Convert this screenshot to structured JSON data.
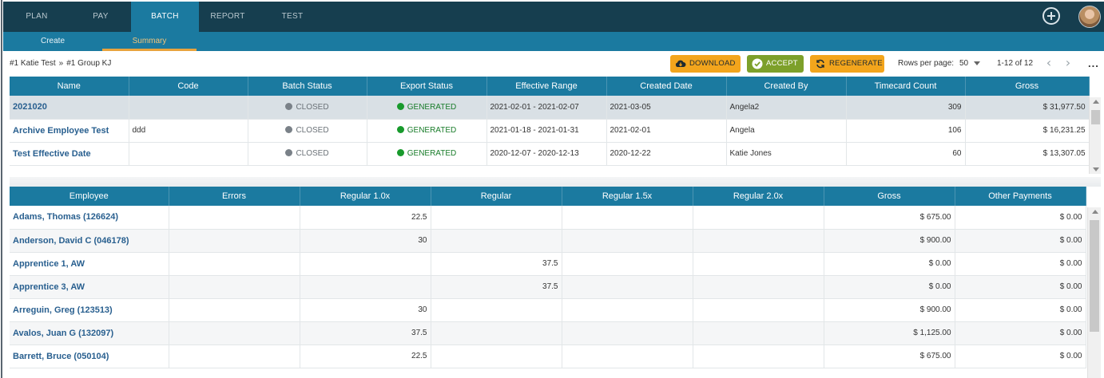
{
  "nav": {
    "tabs": [
      {
        "label": "PLAN"
      },
      {
        "label": "PAY"
      },
      {
        "label": "BATCH"
      },
      {
        "label": "REPORT"
      },
      {
        "label": "TEST"
      }
    ],
    "active_tab": "BATCH"
  },
  "subnav": {
    "tabs": [
      {
        "label": "Create"
      },
      {
        "label": "Summary"
      }
    ],
    "active_tab": "Summary"
  },
  "breadcrumb": {
    "items": [
      "#1 Katie Test",
      "»",
      "#1 Group KJ"
    ]
  },
  "toolbar": {
    "download_label": "DOWNLOAD",
    "accept_label": "ACCEPT",
    "regenerate_label": "REGENERATE",
    "rows_per_page_label": "Rows per page:",
    "rows_per_page_value": "50",
    "range_label": "1-12 of 12",
    "prev_icon": "chevron-left-icon",
    "next_icon": "chevron-right-icon",
    "more_label": "..."
  },
  "colors": {
    "nav_bg": "#163e4f",
    "accent": "#1b7aa0",
    "orange": "#f3a51c",
    "green": "#7da02a",
    "status_closed": "#7a8188",
    "status_generated": "#189a2c"
  },
  "batch_table": {
    "columns": [
      "Name",
      "Code",
      "Batch Status",
      "Export Status",
      "Effective Range",
      "Created Date",
      "Created By",
      "Timecard Count",
      "Gross"
    ],
    "rows": [
      {
        "name": "2021020",
        "code": "",
        "batch_status": "CLOSED",
        "export_status": "GENERATED",
        "effective_range": "2021-02-01 - 2021-02-07",
        "created_date": "2021-03-05",
        "created_by": "Angela2",
        "timecard_count": "309",
        "gross": "$ 31,977.50"
      },
      {
        "name": "Archive Employee Test",
        "code": "ddd",
        "batch_status": "CLOSED",
        "export_status": "GENERATED",
        "effective_range": "2021-01-18 - 2021-01-31",
        "created_date": "2021-02-01",
        "created_by": "Angela",
        "timecard_count": "106",
        "gross": "$ 16,231.25"
      },
      {
        "name": "Test Effective Date",
        "code": "",
        "batch_status": "CLOSED",
        "export_status": "GENERATED",
        "effective_range": "2020-12-07 - 2020-12-13",
        "created_date": "2020-12-22",
        "created_by": "Katie Jones",
        "timecard_count": "60",
        "gross": "$ 13,307.05"
      }
    ]
  },
  "employee_table": {
    "columns": [
      "Employee",
      "Errors",
      "Regular 1.0x",
      "Regular",
      "Regular 1.5x",
      "Regular 2.0x",
      "Gross",
      "Other Payments"
    ],
    "rows": [
      {
        "employee": "Adams, Thomas (126624)",
        "errors": "",
        "reg10": "22.5",
        "regular": "",
        "reg15": "",
        "reg20": "",
        "gross": "$ 675.00",
        "other": "$ 0.00"
      },
      {
        "employee": "Anderson, David C (046178)",
        "errors": "",
        "reg10": "30",
        "regular": "",
        "reg15": "",
        "reg20": "",
        "gross": "$ 900.00",
        "other": "$ 0.00"
      },
      {
        "employee": "Apprentice 1, AW",
        "errors": "",
        "reg10": "",
        "regular": "37.5",
        "reg15": "",
        "reg20": "",
        "gross": "$ 0.00",
        "other": "$ 0.00"
      },
      {
        "employee": "Apprentice 3, AW",
        "errors": "",
        "reg10": "",
        "regular": "37.5",
        "reg15": "",
        "reg20": "",
        "gross": "$ 0.00",
        "other": "$ 0.00"
      },
      {
        "employee": "Arreguin, Greg (123513)",
        "errors": "",
        "reg10": "30",
        "regular": "",
        "reg15": "",
        "reg20": "",
        "gross": "$ 900.00",
        "other": "$ 0.00"
      },
      {
        "employee": "Avalos, Juan G (132097)",
        "errors": "",
        "reg10": "37.5",
        "regular": "",
        "reg15": "",
        "reg20": "",
        "gross": "$ 1,125.00",
        "other": "$ 0.00"
      },
      {
        "employee": "Barrett, Bruce (050104)",
        "errors": "",
        "reg10": "22.5",
        "regular": "",
        "reg15": "",
        "reg20": "",
        "gross": "$ 675.00",
        "other": "$ 0.00"
      }
    ]
  }
}
